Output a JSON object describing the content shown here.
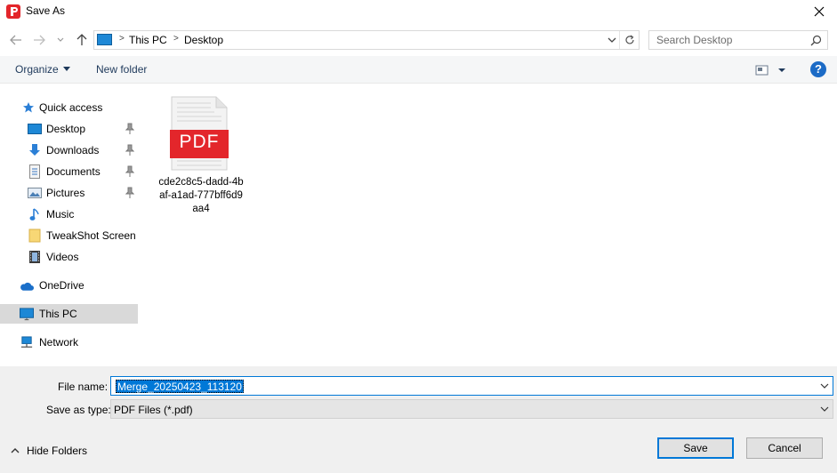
{
  "window": {
    "title": "Save As",
    "app_icon": "pdf-app-icon",
    "accent_color": "#0078d7",
    "pdf_brand_color": "#e3262b"
  },
  "address_bar": {
    "crumbs": [
      "This PC",
      "Desktop"
    ],
    "search_placeholder": "Search Desktop"
  },
  "command_bar": {
    "organize_label": "Organize",
    "new_folder_label": "New folder",
    "help_label": "?"
  },
  "nav_pane": {
    "items": [
      {
        "label": "Quick access",
        "icon": "star-icon"
      },
      {
        "label": "Desktop",
        "icon": "desktop-folder-icon",
        "pinned": true
      },
      {
        "label": "Downloads",
        "icon": "download-arrow-icon",
        "pinned": true
      },
      {
        "label": "Documents",
        "icon": "documents-icon",
        "pinned": true
      },
      {
        "label": "Pictures",
        "icon": "pictures-icon",
        "pinned": true
      },
      {
        "label": "Music",
        "icon": "music-note-icon"
      },
      {
        "label": "TweakShot Screen C",
        "icon": "folder-icon"
      },
      {
        "label": "Videos",
        "icon": "film-icon"
      },
      {
        "label": "OneDrive",
        "icon": "cloud-icon"
      },
      {
        "label": "This PC",
        "icon": "monitor-icon",
        "selected": true
      },
      {
        "label": "Network",
        "icon": "network-icon"
      }
    ]
  },
  "content": {
    "files": [
      {
        "name": "cde2c8c5-dadd-4baf-a1ad-777bff6d9aa4",
        "badge": "PDF",
        "icon": "pdf-file-icon"
      }
    ]
  },
  "form": {
    "file_name_label": "File name:",
    "file_name_value": "Merge_20250423_113120",
    "save_type_label": "Save as type:",
    "save_type_value": "PDF Files (*.pdf)"
  },
  "footer": {
    "hide_folders_label": "Hide Folders",
    "save_label": "Save",
    "cancel_label": "Cancel"
  }
}
